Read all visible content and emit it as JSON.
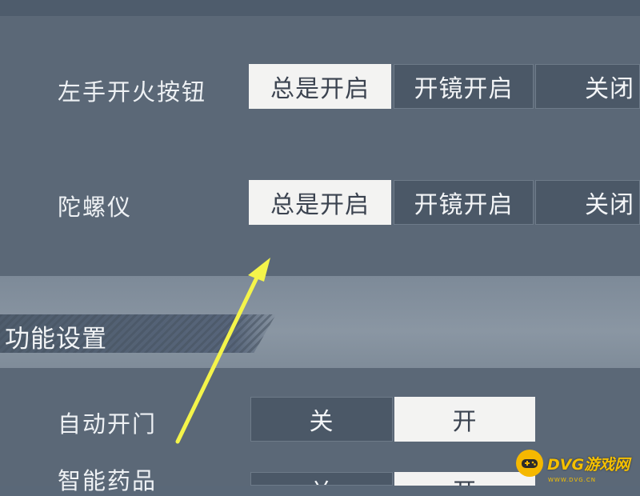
{
  "settings": {
    "left_fire": {
      "label": "左手开火按钮",
      "options": [
        "总是开启",
        "开镜开启",
        "关闭"
      ],
      "selected": "总是开启"
    },
    "gyroscope": {
      "label": "陀螺仪",
      "options": [
        "总是开启",
        "开镜开启",
        "关闭"
      ],
      "selected": "总是开启"
    }
  },
  "function_section": {
    "title": "功能设置",
    "auto_door": {
      "label": "自动开门",
      "options": [
        "关",
        "开"
      ],
      "selected": "开"
    },
    "smart_medicine": {
      "label": "智能药品",
      "options": [
        "关",
        "开"
      ],
      "selected": "开"
    }
  },
  "watermark": {
    "brand": "DVG游戏网",
    "url": "WWW.DVG.CN"
  },
  "colors": {
    "panel": "#5b6877",
    "selected_segment": "#f3f3f2",
    "unselected_segment": "#4b5867",
    "annotation_arrow": "#f4f44a",
    "brand_yellow": "#f5b800"
  }
}
